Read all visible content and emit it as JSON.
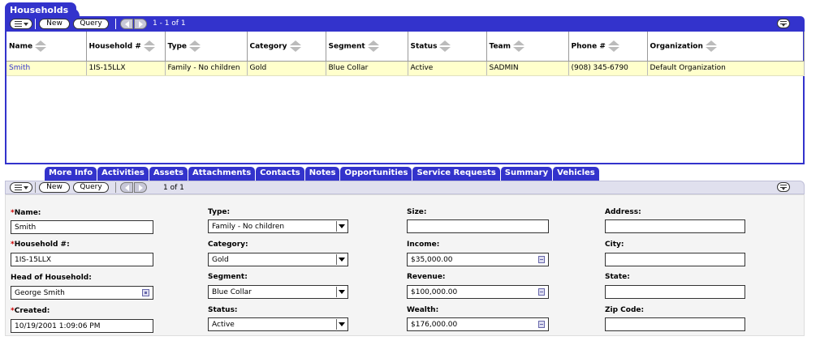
{
  "households": {
    "title": "Households",
    "new_label": "New",
    "query_label": "Query",
    "record_count": "1 - 1 of 1",
    "columns": [
      "Name",
      "Household #",
      "Type",
      "Category",
      "Segment",
      "Status",
      "Team",
      "Phone #",
      "Organization"
    ],
    "rows": [
      [
        "Smith",
        "1IS-15LLX",
        "Family - No children",
        "Gold",
        "Blue Collar",
        "Active",
        "SADMIN",
        "(908) 345-6790",
        "Default Organization"
      ]
    ]
  },
  "detail": {
    "tabs": [
      "More Info",
      "Activities",
      "Assets",
      "Attachments",
      "Contacts",
      "Notes",
      "Opportunities",
      "Service Requests",
      "Summary",
      "Vehicles"
    ],
    "new_label": "New",
    "query_label": "Query",
    "record_count": "1 of 1",
    "required_marker": "*",
    "fields": {
      "name": {
        "label": "Name:",
        "value": "Smith"
      },
      "household_num": {
        "label": "Household #:",
        "value": "1IS-15LLX"
      },
      "head": {
        "label": "Head of Household:",
        "value": "George Smith"
      },
      "created": {
        "label": "Created:",
        "value": "10/19/2001 1:09:06 PM"
      },
      "type": {
        "label": "Type:",
        "value": "Family - No children"
      },
      "category": {
        "label": "Category:",
        "value": "Gold"
      },
      "segment": {
        "label": "Segment:",
        "value": "Blue Collar"
      },
      "status": {
        "label": "Status:",
        "value": "Active"
      },
      "size": {
        "label": "Size:",
        "value": ""
      },
      "income": {
        "label": "Income:",
        "value": "$35,000.00"
      },
      "revenue": {
        "label": "Revenue:",
        "value": "$100,000.00"
      },
      "wealth": {
        "label": "Wealth:",
        "value": "$176,000.00"
      },
      "address": {
        "label": "Address:",
        "value": ""
      },
      "city": {
        "label": "City:",
        "value": ""
      },
      "state": {
        "label": "State:",
        "value": ""
      },
      "zip": {
        "label": "Zip Code:",
        "value": ""
      }
    }
  },
  "colors": {
    "accent": "#3333cc",
    "selected_row": "#ffffcc",
    "required": "#cc0000"
  }
}
